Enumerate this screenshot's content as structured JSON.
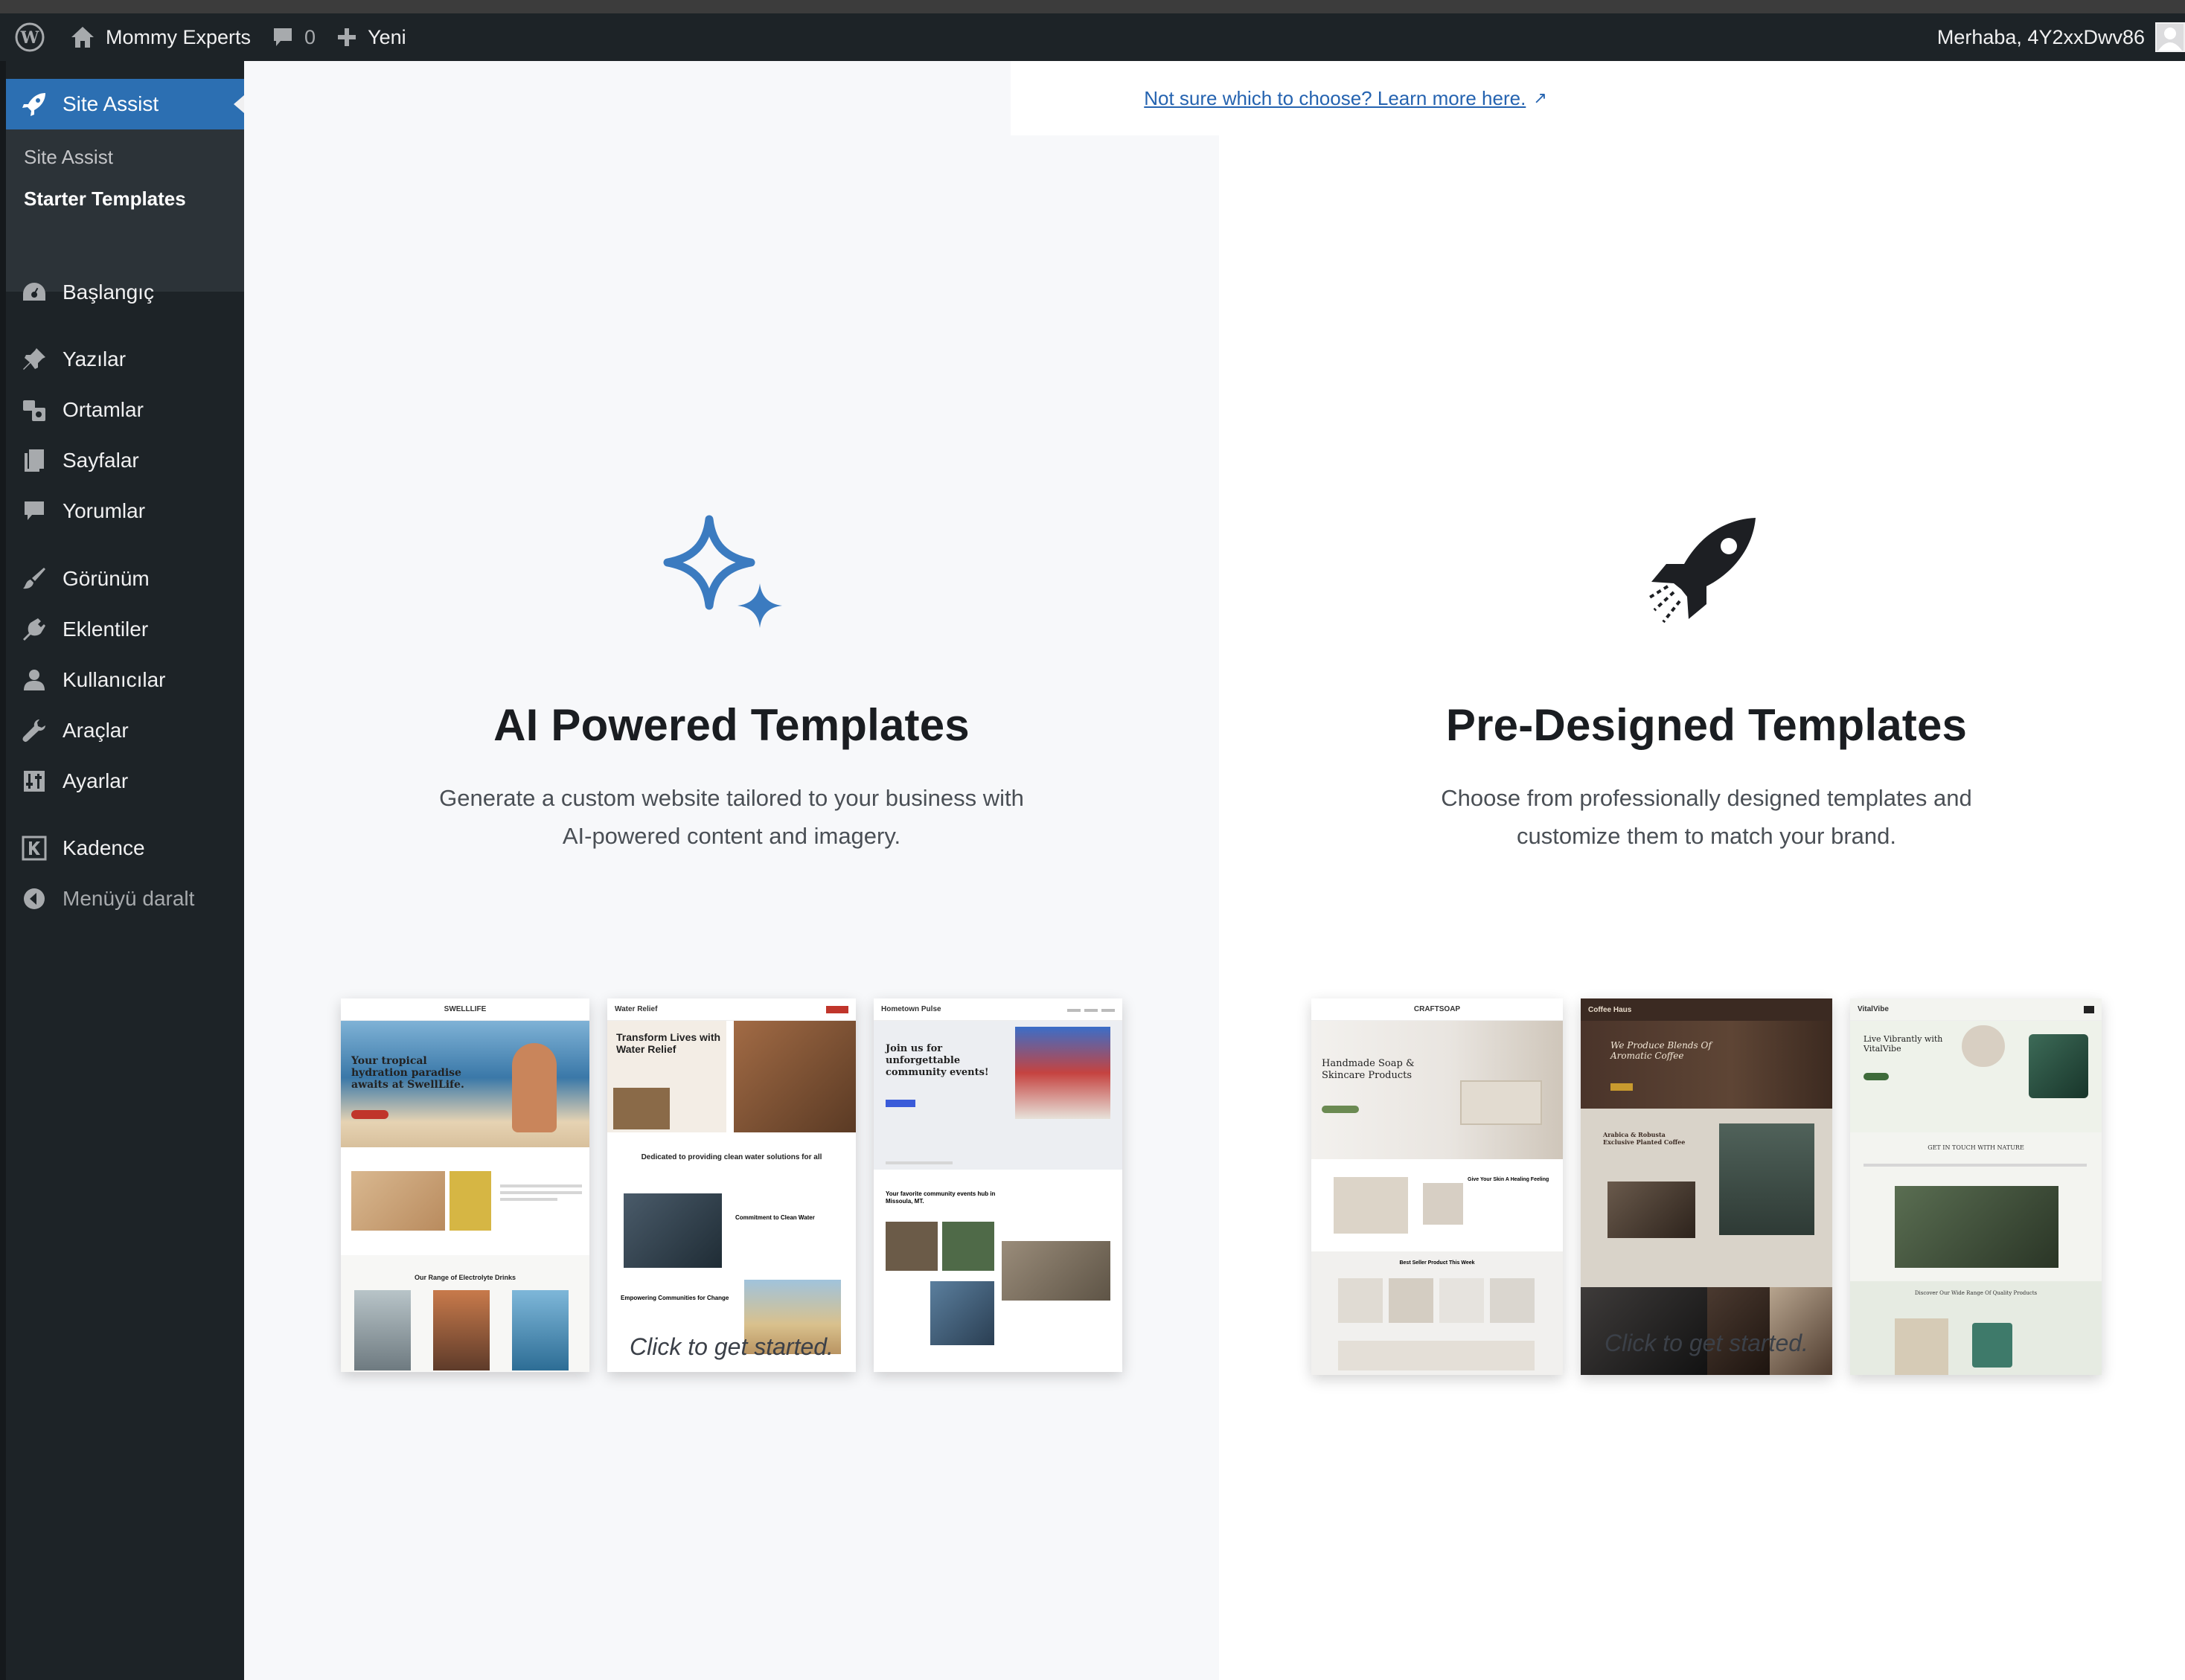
{
  "adminbar": {
    "site_name": "Mommy Experts",
    "comments_count": "0",
    "new_label": "Yeni",
    "greeting": "Merhaba, 4Y2xxDwv86"
  },
  "sidebar": {
    "current": "Site Assist",
    "submenu": [
      "Site Assist",
      "Starter Templates"
    ],
    "items": [
      {
        "label": "Başlangıç",
        "icon": "dashboard-icon"
      },
      {
        "label": "Yazılar",
        "icon": "pushpin-icon"
      },
      {
        "label": "Ortamlar",
        "icon": "media-icon"
      },
      {
        "label": "Sayfalar",
        "icon": "pages-icon"
      },
      {
        "label": "Yorumlar",
        "icon": "comment-icon"
      },
      {
        "label": "Görünüm",
        "icon": "paintbrush-icon"
      },
      {
        "label": "Eklentiler",
        "icon": "plugin-icon"
      },
      {
        "label": "Kullanıcılar",
        "icon": "users-icon"
      },
      {
        "label": "Araçlar",
        "icon": "wrench-icon"
      },
      {
        "label": "Ayarlar",
        "icon": "settings-icon"
      },
      {
        "label": "Kadence",
        "icon": "kadence-icon"
      },
      {
        "label": "Menüyü daralt",
        "icon": "collapse-icon"
      }
    ]
  },
  "main": {
    "help_link": "Not sure which to choose? Learn more here.",
    "ai": {
      "title": "AI Powered Templates",
      "description": "Generate a custom website tailored to your business with AI-powered content and imagery.",
      "cta": "Click to get started.",
      "accent": "#3b7bc0"
    },
    "predesigned": {
      "title": "Pre-Designed Templates",
      "description": "Choose from professionally designed templates and customize them to match your brand.",
      "cta": "Click to get started."
    },
    "previews": {
      "swell": {
        "logo": "SWELLLIFE",
        "headline": "Your tropical hydration paradise awaits at SwellLife.",
        "section": "Our Range of Electrolyte Drinks"
      },
      "water": {
        "logo": "Water Relief",
        "headline": "Transform Lives with Water Relief",
        "section": "Dedicated to providing clean water solutions for all",
        "sub1": "Commitment to Clean Water",
        "sub2": "Empowering Communities for Change"
      },
      "community": {
        "logo": "Hometown Pulse",
        "headline": "Join us for unforgettable community events!",
        "section": "Your favorite community events hub in Missoula, MT."
      },
      "soap": {
        "logo": "CRAFTSOAP",
        "headline": "Handmade Soap & Skincare Products",
        "section": "Best Seller Product This Week",
        "side": "Give Your Skin A Healing Feeling"
      },
      "coffee": {
        "logo": "Coffee Haus",
        "headline": "We Produce Blends Of Aromatic Coffee",
        "section": "Arabica & Robusta Exclusive Planted Coffee"
      },
      "vital": {
        "logo": "VitalVibe",
        "headline": "Live Vibrantly with VitalVibe",
        "section": "GET IN TOUCH WITH NATURE",
        "footer": "Discover Our Wide Range Of Quality Products"
      }
    }
  }
}
